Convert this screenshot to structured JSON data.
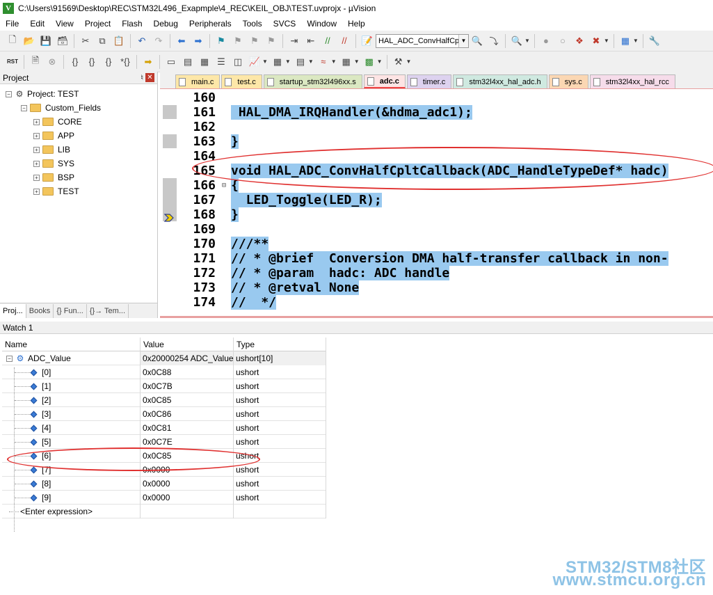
{
  "window": {
    "title": "C:\\Users\\91569\\Desktop\\REC\\STM32L496_Exapmple\\4_REC\\KEIL_OBJ\\TEST.uvprojx - µVision",
    "app_icon": "V"
  },
  "menu": [
    "File",
    "Edit",
    "View",
    "Project",
    "Flash",
    "Debug",
    "Peripherals",
    "Tools",
    "SVCS",
    "Window",
    "Help"
  ],
  "toolbar": {
    "find_combo_value": "HAL_ADC_ConvHalfCpltC",
    "rst_label_top": "RST"
  },
  "project_panel": {
    "title": "Project",
    "root": "Project: TEST",
    "group": "Custom_Fields",
    "folders": [
      "CORE",
      "APP",
      "LIB",
      "SYS",
      "BSP",
      "TEST"
    ],
    "tabs": [
      "Proj...",
      "Books",
      "{} Fun...",
      "{}→ Tem..."
    ]
  },
  "editor": {
    "tabs": [
      "main.c",
      "test.c",
      "startup_stm32l496xx.s",
      "adc.c",
      "timer.c",
      "stm32l4xx_hal_adc.h",
      "sys.c",
      "stm32l4xx_hal_rcc"
    ],
    "active_tab": "adc.c",
    "lines": [
      {
        "num": "160",
        "code": "",
        "fold": ""
      },
      {
        "num": "161",
        "code": " HAL_DMA_IRQHandler(&hdma_adc1);",
        "fold": ""
      },
      {
        "num": "162",
        "code": "",
        "fold": ""
      },
      {
        "num": "163",
        "code": "}",
        "fold": ""
      },
      {
        "num": "164",
        "code": "",
        "fold": ""
      },
      {
        "num": "165",
        "code": "void HAL_ADC_ConvHalfCpltCallback(ADC_HandleTypeDef* hadc)",
        "fold": ""
      },
      {
        "num": "166",
        "code": "{",
        "fold": "⊟"
      },
      {
        "num": "167",
        "code": "  LED_Toggle(LED_R);",
        "fold": ""
      },
      {
        "num": "168",
        "code": "}",
        "fold": ""
      },
      {
        "num": "169",
        "code": "",
        "fold": ""
      },
      {
        "num": "170",
        "code": "///**",
        "fold": ""
      },
      {
        "num": "171",
        "code": "// * @brief  Conversion DMA half-transfer callback in non-",
        "fold": ""
      },
      {
        "num": "172",
        "code": "// * @param  hadc: ADC handle",
        "fold": ""
      },
      {
        "num": "173",
        "code": "// * @retval None",
        "fold": ""
      },
      {
        "num": "174",
        "code": "//  */",
        "fold": ""
      }
    ]
  },
  "watch": {
    "title": "Watch 1",
    "headers": {
      "name": "Name",
      "value": "Value",
      "type": "Type"
    },
    "parent": {
      "name": "ADC_Value",
      "value": "0x20000254 ADC_Value",
      "type": "ushort[10]"
    },
    "items": [
      {
        "name": "[0]",
        "value": "0x0C88",
        "type": "ushort"
      },
      {
        "name": "[1]",
        "value": "0x0C7B",
        "type": "ushort"
      },
      {
        "name": "[2]",
        "value": "0x0C85",
        "type": "ushort"
      },
      {
        "name": "[3]",
        "value": "0x0C86",
        "type": "ushort"
      },
      {
        "name": "[4]",
        "value": "0x0C81",
        "type": "ushort"
      },
      {
        "name": "[5]",
        "value": "0x0C7E",
        "type": "ushort"
      },
      {
        "name": "[6]",
        "value": "0x0C85",
        "type": "ushort"
      },
      {
        "name": "[7]",
        "value": "0x0000",
        "type": "ushort"
      },
      {
        "name": "[8]",
        "value": "0x0000",
        "type": "ushort"
      },
      {
        "name": "[9]",
        "value": "0x0000",
        "type": "ushort"
      }
    ],
    "enter_expression": "<Enter expression>"
  },
  "watermark": {
    "line1": "STM32/STM8社区",
    "line2": "www.stmcu.org.cn"
  },
  "colors": {
    "selection": "#99c9ef",
    "annotation": "#e0302f",
    "watermark": "#8ec3e6"
  }
}
